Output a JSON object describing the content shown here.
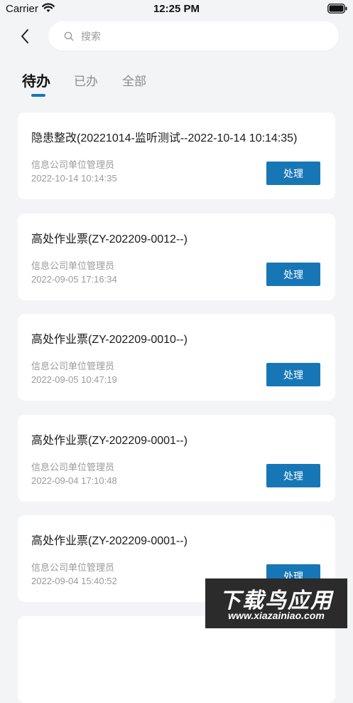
{
  "status_bar": {
    "carrier": "Carrier",
    "time": "12:25 PM"
  },
  "search": {
    "placeholder": "搜索"
  },
  "tabs": [
    {
      "label": "待办",
      "active": true
    },
    {
      "label": "已办",
      "active": false
    },
    {
      "label": "全部",
      "active": false
    }
  ],
  "items": [
    {
      "title": "隐患整改(20221014-监听测试--2022-10-14 10:14:35)",
      "org": "信息公司单位管理员",
      "time": "2022-10-14 10:14:35",
      "action": "处理"
    },
    {
      "title": "高处作业票(ZY-202209-0012--)",
      "org": "信息公司单位管理员",
      "time": "2022-09-05 17:16:34",
      "action": "处理"
    },
    {
      "title": "高处作业票(ZY-202209-0010--)",
      "org": "信息公司单位管理员",
      "time": "2022-09-05 10:47:19",
      "action": "处理"
    },
    {
      "title": "高处作业票(ZY-202209-0001--)",
      "org": "信息公司单位管理员",
      "time": "2022-09-04 17:10:48",
      "action": "处理"
    },
    {
      "title": "高处作业票(ZY-202209-0001--)",
      "org": "信息公司单位管理员",
      "time": "2022-09-04 15:40:52",
      "action": "处理"
    }
  ],
  "watermark": {
    "title": "下载鸟应用",
    "url": "www.xiazainiao.com"
  },
  "colors": {
    "accent": "#1777b6",
    "background": "#f3f4f6"
  }
}
